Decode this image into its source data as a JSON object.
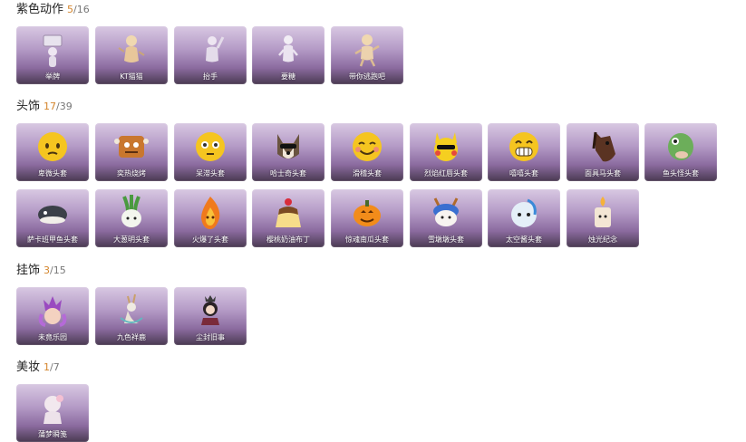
{
  "sections": [
    {
      "title": "紫色动作",
      "owned": "5",
      "total": "/16",
      "items": [
        {
          "label": "举牌",
          "icon": "sign-pose-icon"
        },
        {
          "label": "KT猫猫",
          "icon": "cat-pose-icon"
        },
        {
          "label": "抬手",
          "icon": "raise-hand-pose-icon"
        },
        {
          "label": "要糖",
          "icon": "ask-candy-pose-icon"
        },
        {
          "label": "带你逃跑吧",
          "icon": "run-away-pose-icon"
        }
      ]
    },
    {
      "title": "头饰",
      "owned": "17",
      "total": "/39",
      "items": [
        {
          "label": "卑微头套",
          "icon": "worried-face-icon"
        },
        {
          "label": "奕热烧烤",
          "icon": "bbq-icon"
        },
        {
          "label": "呆滞头套",
          "icon": "dazed-face-icon"
        },
        {
          "label": "哈士奇头套",
          "icon": "husky-icon"
        },
        {
          "label": "滑稽头套",
          "icon": "grin-face-icon"
        },
        {
          "label": "烈焰红唇头套",
          "icon": "pikachu-icon"
        },
        {
          "label": "嘻嘻头套",
          "icon": "laugh-face-icon"
        },
        {
          "label": "面具马头套",
          "icon": "horse-head-icon"
        },
        {
          "label": "鱼头怪头套",
          "icon": "fish-head-icon"
        },
        {
          "label": "萨卡班甲鱼头套",
          "icon": "fish-head-dark-icon"
        },
        {
          "label": "大葱明头套",
          "icon": "scallion-icon"
        },
        {
          "label": "火爆了头套",
          "icon": "flame-icon"
        },
        {
          "label": "樱桃奶油布丁",
          "icon": "pudding-icon"
        },
        {
          "label": "惊魂南瓜头套",
          "icon": "pumpkin-icon"
        },
        {
          "label": "雪墩墩头套",
          "icon": "snow-deer-icon"
        },
        {
          "label": "太空酱头套",
          "icon": "space-shark-icon"
        },
        {
          "label": "烛光纪念",
          "icon": "candle-icon"
        }
      ]
    },
    {
      "title": "挂饰",
      "owned": "3",
      "total": "/15",
      "items": [
        {
          "label": "未竟乐园",
          "icon": "jester-charm-icon"
        },
        {
          "label": "九色祥鹿",
          "icon": "deer-charm-icon"
        },
        {
          "label": "尘封旧事",
          "icon": "doll-charm-icon"
        }
      ]
    },
    {
      "title": "美妆",
      "owned": "1",
      "total": "/7",
      "items": [
        {
          "label": "蒲梦瞬笺",
          "icon": "makeup-character-icon"
        }
      ]
    }
  ]
}
